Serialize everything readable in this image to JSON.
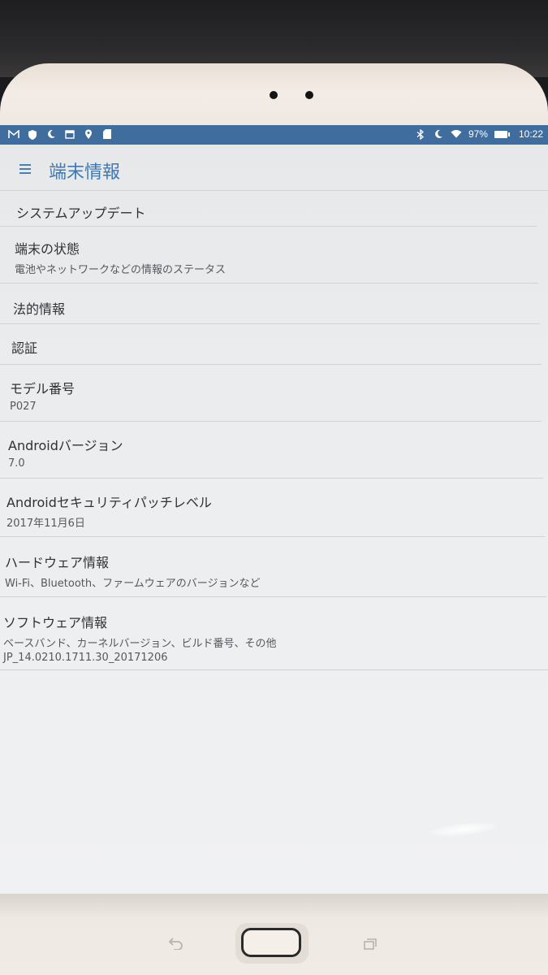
{
  "status_bar": {
    "left_icons": [
      "gmail-icon",
      "shield-icon",
      "moon-icon",
      "calendar-icon",
      "location-icon",
      "sd-card-icon"
    ],
    "right_icons": [
      "bluetooth-icon",
      "moon-icon",
      "wifi-icon"
    ],
    "battery": "97%",
    "time": "10:22",
    "color": "#3f6d9e"
  },
  "app_bar": {
    "title": "端末情報",
    "accent_color": "#3f78b3"
  },
  "items": [
    {
      "title": "システムアップデート",
      "subtitle": ""
    },
    {
      "title": "端末の状態",
      "subtitle": "電池やネットワークなどの情報のステータス"
    },
    {
      "title": "法的情報",
      "subtitle": ""
    },
    {
      "title": "認証",
      "subtitle": ""
    },
    {
      "title": "モデル番号",
      "subtitle": "P027"
    },
    {
      "title": "Androidバージョン",
      "subtitle": "7.0"
    },
    {
      "title": "Androidセキュリティパッチレベル",
      "subtitle": "2017年11月6日"
    },
    {
      "title": "ハードウェア情報",
      "subtitle": "Wi-Fi、Bluetooth、ファームウェアのバージョンなど"
    },
    {
      "title": "ソフトウェア情報",
      "subtitle": "ベースバンド、カーネルバージョン、ビルド番号、その他",
      "subtitle2": "JP_14.0210.1711.30_20171206"
    }
  ],
  "hardware_keys": [
    "back-icon",
    "home-button",
    "recents-icon"
  ]
}
